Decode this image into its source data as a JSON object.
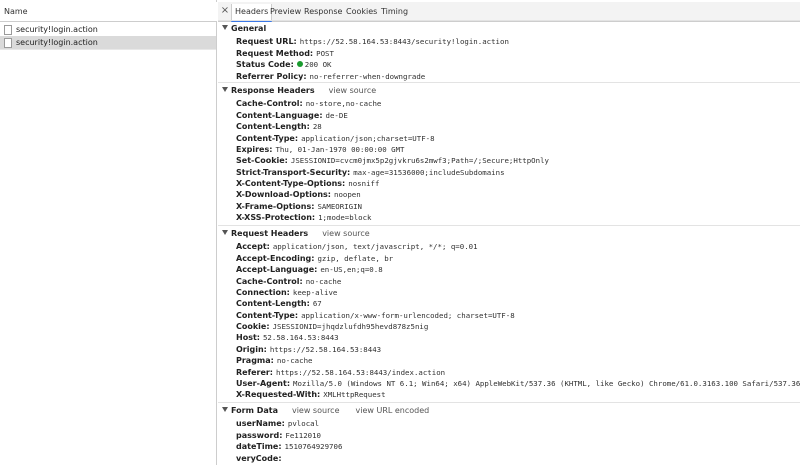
{
  "left": {
    "column_header": "Name",
    "requests": [
      "security!login.action",
      "security!login.action"
    ]
  },
  "tabs": {
    "close": "×",
    "headers": "Headers",
    "preview": "Preview",
    "response": "Response",
    "cookies": "Cookies",
    "timing": "Timing",
    "active": "Headers"
  },
  "general": {
    "title": "General",
    "rows": [
      {
        "k": "Request URL:",
        "v": "https://52.58.164.53:8443/security!login.action"
      },
      {
        "k": "Request Method:",
        "v": "POST"
      },
      {
        "k": "Status Code:",
        "v": "200 OK",
        "status_color": "#1a9b2f"
      },
      {
        "k": "Referrer Policy:",
        "v": "no-referrer-when-downgrade"
      }
    ]
  },
  "response_headers": {
    "title": "Response Headers",
    "view_source": "view source",
    "rows": [
      {
        "k": "Cache-Control:",
        "v": "no-store,no-cache"
      },
      {
        "k": "Content-Language:",
        "v": "de-DE"
      },
      {
        "k": "Content-Length:",
        "v": "28"
      },
      {
        "k": "Content-Type:",
        "v": "application/json;charset=UTF-8"
      },
      {
        "k": "Expires:",
        "v": "Thu, 01-Jan-1970 00:00:00 GMT"
      },
      {
        "k": "Set-Cookie:",
        "v": "JSESSIONID=cvcm0jmx5p2gjvkru6s2mwf3;Path=/;Secure;HttpOnly"
      },
      {
        "k": "Strict-Transport-Security:",
        "v": "max-age=31536000;includeSubdomains"
      },
      {
        "k": "X-Content-Type-Options:",
        "v": "nosniff"
      },
      {
        "k": "X-Download-Options:",
        "v": "noopen"
      },
      {
        "k": "X-Frame-Options:",
        "v": "SAMEORIGIN"
      },
      {
        "k": "X-XSS-Protection:",
        "v": "1;mode=block"
      }
    ]
  },
  "request_headers": {
    "title": "Request Headers",
    "view_source": "view source",
    "rows": [
      {
        "k": "Accept:",
        "v": "application/json, text/javascript, */*; q=0.01"
      },
      {
        "k": "Accept-Encoding:",
        "v": "gzip, deflate, br"
      },
      {
        "k": "Accept-Language:",
        "v": "en-US,en;q=0.8"
      },
      {
        "k": "Cache-Control:",
        "v": "no-cache"
      },
      {
        "k": "Connection:",
        "v": "keep-alive"
      },
      {
        "k": "Content-Length:",
        "v": "67"
      },
      {
        "k": "Content-Type:",
        "v": "application/x-www-form-urlencoded; charset=UTF-8"
      },
      {
        "k": "Cookie:",
        "v": "JSESSIONID=jhqdzlufdh95hevd878z5nig"
      },
      {
        "k": "Host:",
        "v": "52.58.164.53:8443"
      },
      {
        "k": "Origin:",
        "v": "https://52.58.164.53:8443"
      },
      {
        "k": "Pragma:",
        "v": "no-cache"
      },
      {
        "k": "Referer:",
        "v": "https://52.58.164.53:8443/index.action"
      },
      {
        "k": "User-Agent:",
        "v": "Mozilla/5.0 (Windows NT 6.1; Win64; x64) AppleWebKit/537.36 (KHTML, like Gecko) Chrome/61.0.3163.100 Safari/537.36"
      },
      {
        "k": "X-Requested-With:",
        "v": "XMLHttpRequest"
      }
    ]
  },
  "form_data": {
    "title": "Form Data",
    "view_source": "view source",
    "view_url_encoded": "view URL encoded",
    "rows": [
      {
        "k": "userName:",
        "v": "pvlocal"
      },
      {
        "k": "password:",
        "v": "Fe112010"
      },
      {
        "k": "dateTime:",
        "v": "1510764929706"
      },
      {
        "k": "veryCode:",
        "v": ""
      }
    ]
  }
}
